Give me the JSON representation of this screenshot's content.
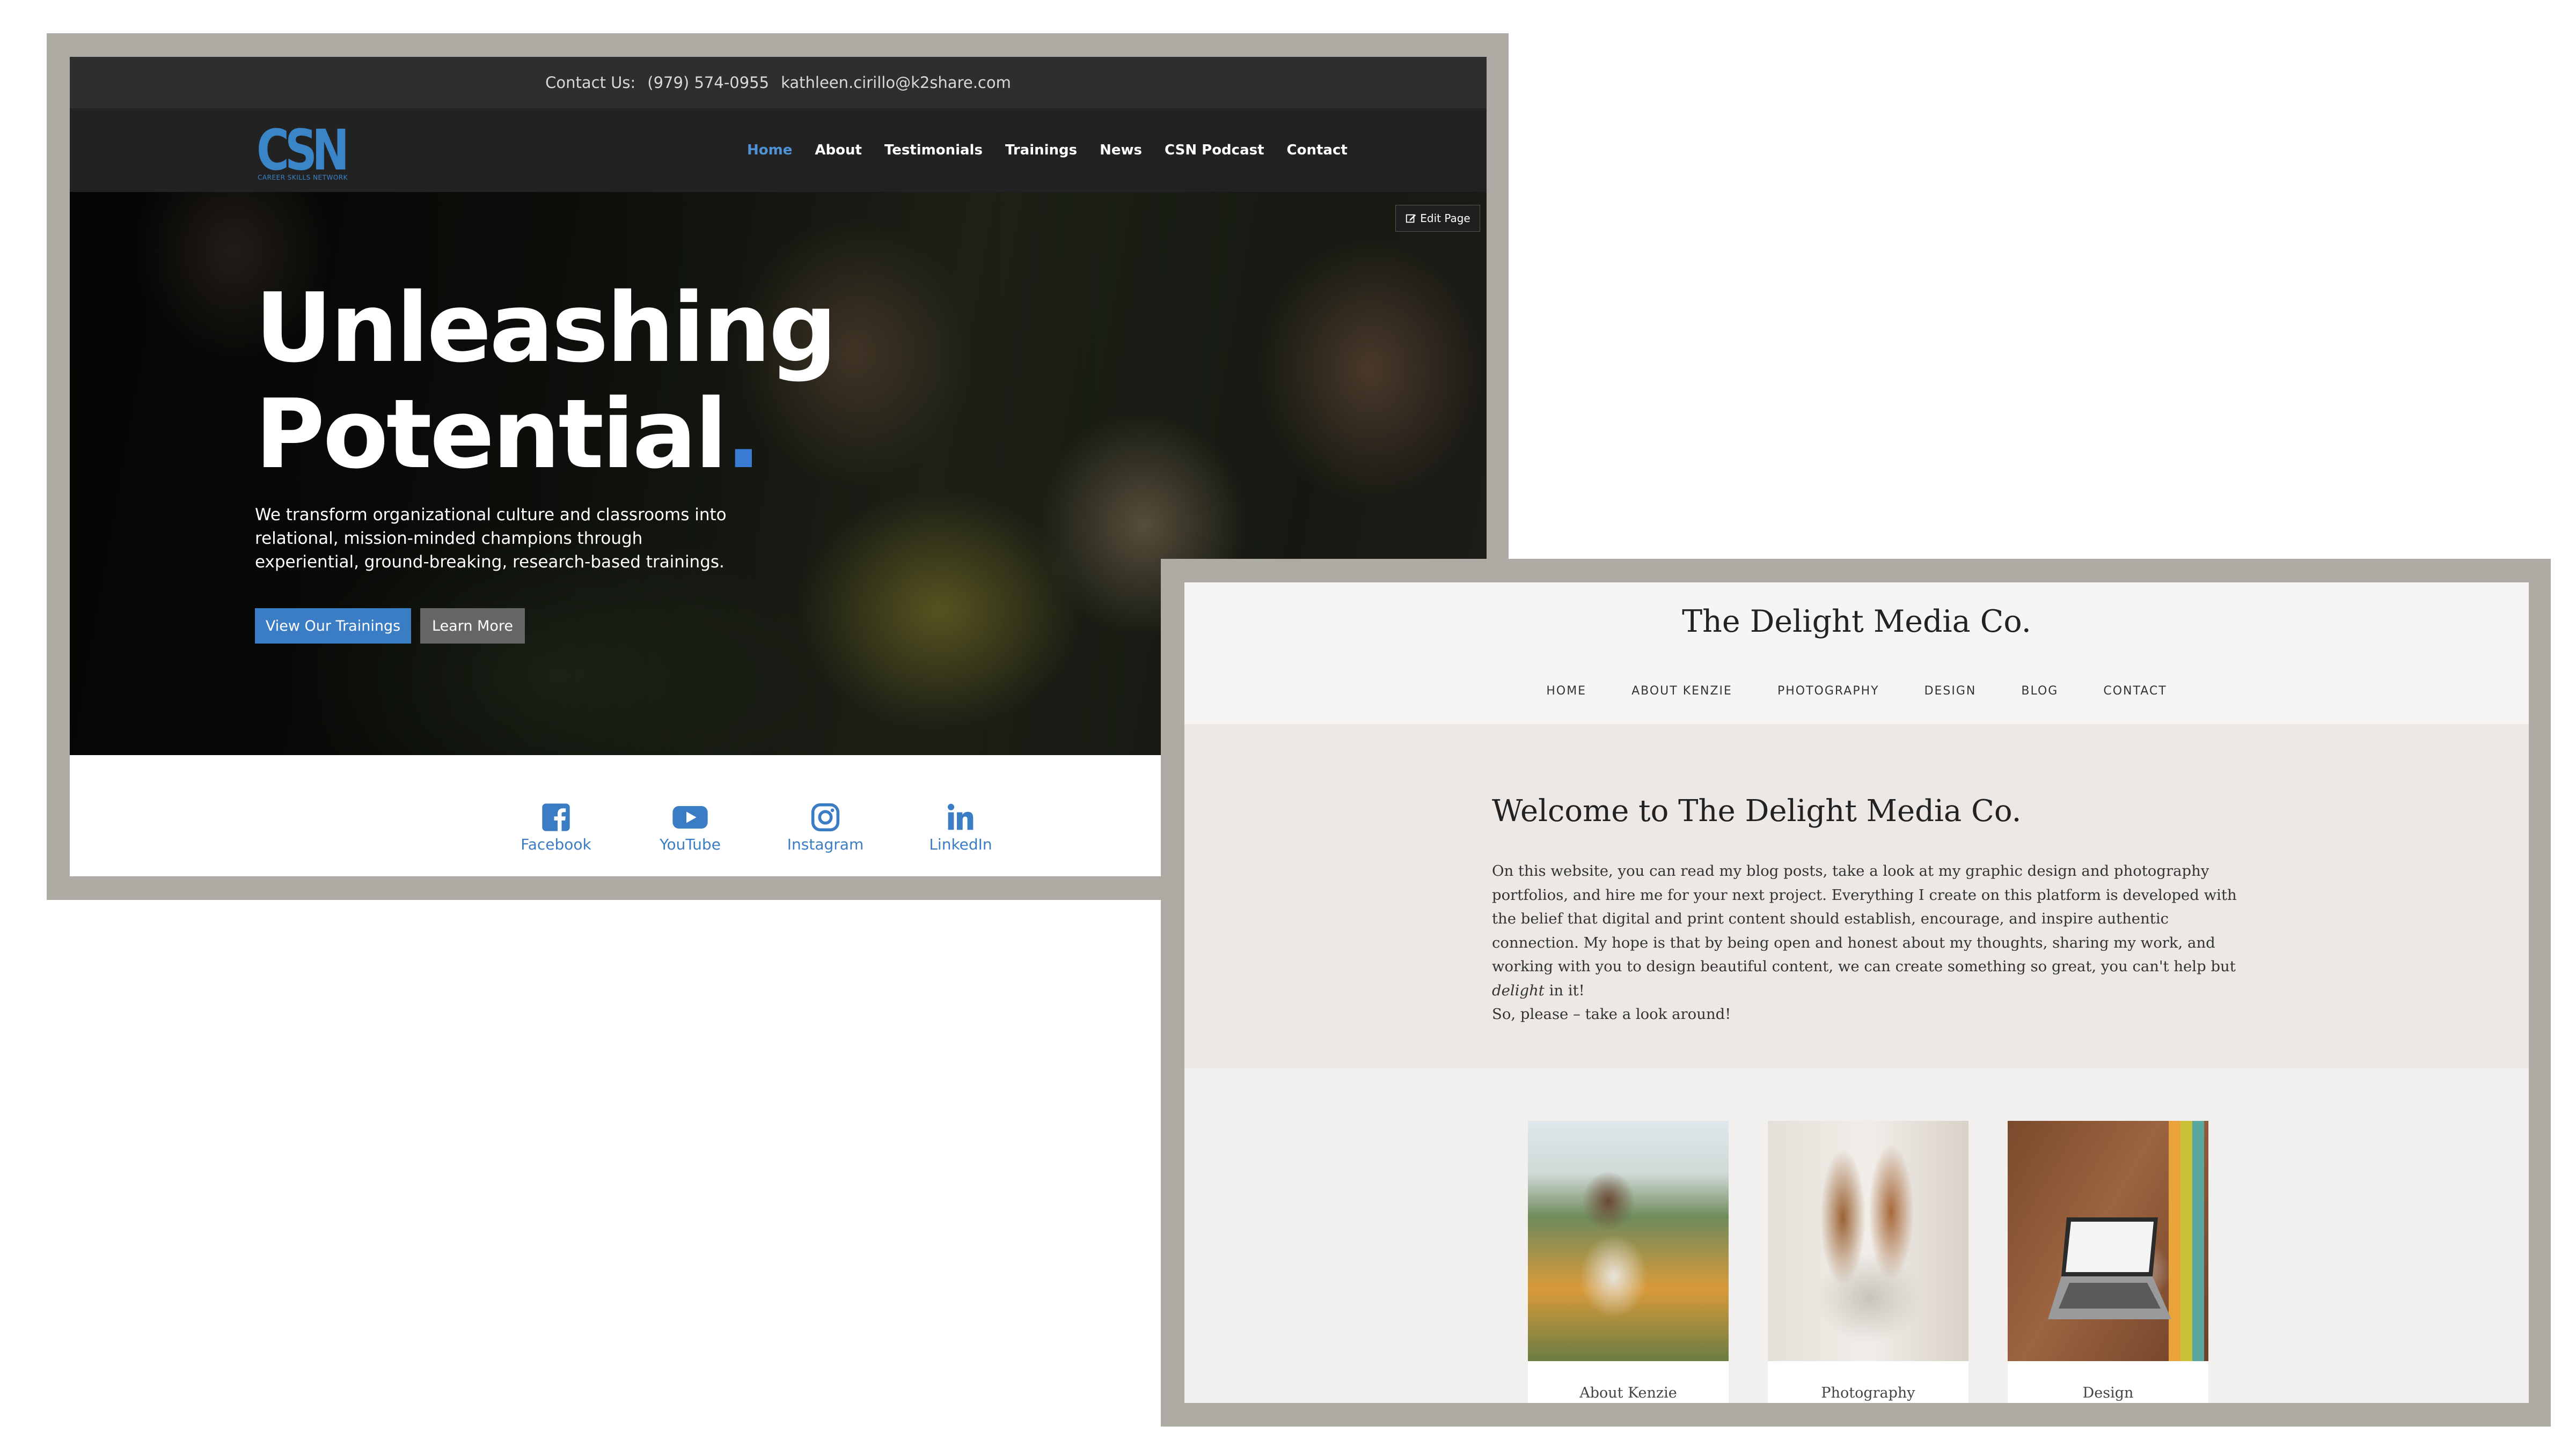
{
  "csn": {
    "topbar": {
      "contact_label": "Contact Us:",
      "phone": "(979) 574-0955",
      "email": "kathleen.cirillo@k2share.com"
    },
    "logo": {
      "text": "CSN",
      "subtext": "CAREER SKILLS NETWORK"
    },
    "nav": {
      "items": [
        "Home",
        "About",
        "Testimonials",
        "Trainings",
        "News",
        "CSN Podcast",
        "Contact"
      ],
      "active": "Home"
    },
    "edit_page_label": "Edit Page",
    "hero": {
      "title_line1": "Unleashing",
      "title_line2": "Potential",
      "title_dot": ".",
      "description": "We transform organizational culture and classrooms into relational, mission-minded champions through experiential, ground-breaking, research-based trainings.",
      "primary_button": "View Our Trainings",
      "secondary_button": "Learn More"
    },
    "social": [
      "Facebook",
      "YouTube",
      "Instagram",
      "LinkedIn"
    ],
    "colors": {
      "accent": "#3b7dc4",
      "nav_bg": "#222222",
      "topbar_bg": "#2e2e2e"
    }
  },
  "delight": {
    "title": "The Delight Media Co.",
    "nav": [
      "HOME",
      "ABOUT KENZIE",
      "PHOTOGRAPHY",
      "DESIGN",
      "BLOG",
      "CONTACT"
    ],
    "welcome_heading": "Welcome to The Delight Media Co.",
    "body_part1": "On this website, you can read my blog posts, take a look at my graphic design and photography portfolios, and hire me for your next project. Everything I create on this platform is developed with the belief that digital and print content should establish, encourage, and inspire authentic connection. My hope is that by being open and honest about my thoughts, sharing my work, and working with you to design beautiful content, we can create something so great, you can't help but ",
    "body_em": "delight",
    "body_part2": " in it!",
    "body_line2": "So, please – take a look around!",
    "cards": [
      "About Kenzie",
      "Photography",
      "Design"
    ]
  }
}
